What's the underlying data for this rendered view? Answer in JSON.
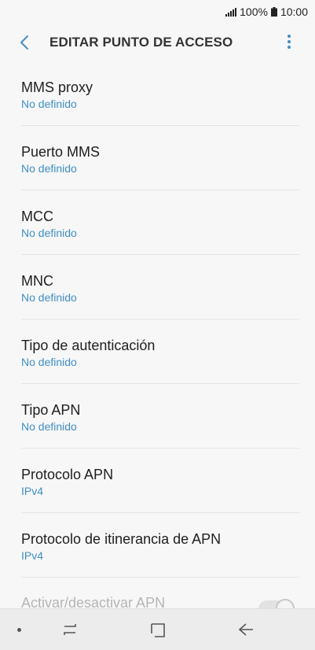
{
  "status": {
    "battery": "100%",
    "time": "10:00"
  },
  "header": {
    "title": "EDITAR PUNTO DE ACCESO"
  },
  "settings": [
    {
      "label": "MMS proxy",
      "value": "No definido"
    },
    {
      "label": "Puerto MMS",
      "value": "No definido"
    },
    {
      "label": "MCC",
      "value": "No definido"
    },
    {
      "label": "MNC",
      "value": "No definido"
    },
    {
      "label": "Tipo de autenticación",
      "value": "No definido"
    },
    {
      "label": "Tipo APN",
      "value": "No definido"
    },
    {
      "label": "Protocolo APN",
      "value": "IPv4"
    },
    {
      "label": "Protocolo de itinerancia de APN",
      "value": "IPv4"
    }
  ],
  "toggle_row": {
    "label": "Activar/desactivar APN",
    "state": "on"
  },
  "colors": {
    "accent": "#3f8fc2",
    "background": "#f7f7f7"
  },
  "icons": {
    "back": "chevron-left-icon",
    "menu": "more-vertical-icon",
    "nav_recent": "recent-apps-icon",
    "nav_home": "home-icon",
    "nav_back": "back-arrow-icon"
  }
}
